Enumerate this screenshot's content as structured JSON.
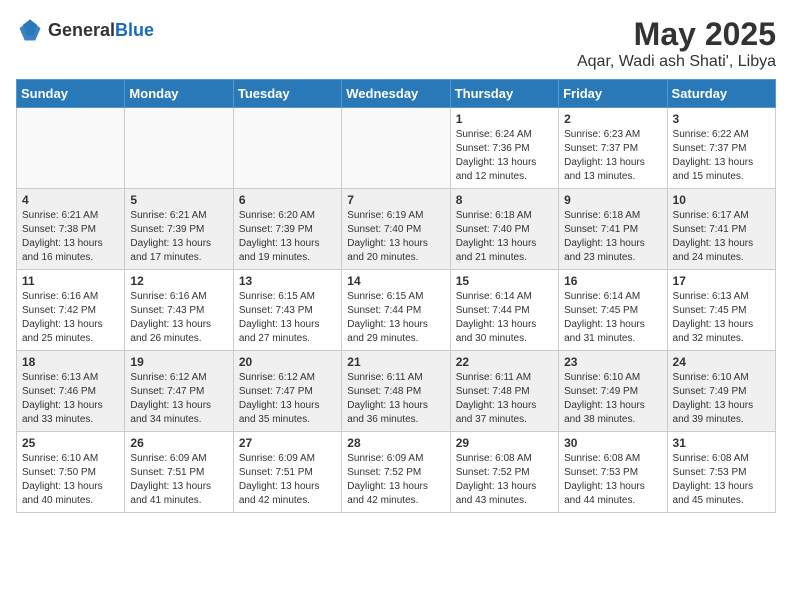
{
  "header": {
    "logo_general": "General",
    "logo_blue": "Blue",
    "month_year": "May 2025",
    "location": "Aqar, Wadi ash Shati', Libya"
  },
  "weekdays": [
    "Sunday",
    "Monday",
    "Tuesday",
    "Wednesday",
    "Thursday",
    "Friday",
    "Saturday"
  ],
  "weeks": [
    [
      {
        "day": "",
        "sunrise": "",
        "sunset": "",
        "daylight": ""
      },
      {
        "day": "",
        "sunrise": "",
        "sunset": "",
        "daylight": ""
      },
      {
        "day": "",
        "sunrise": "",
        "sunset": "",
        "daylight": ""
      },
      {
        "day": "",
        "sunrise": "",
        "sunset": "",
        "daylight": ""
      },
      {
        "day": "1",
        "sunrise": "Sunrise: 6:24 AM",
        "sunset": "Sunset: 7:36 PM",
        "daylight": "Daylight: 13 hours and 12 minutes."
      },
      {
        "day": "2",
        "sunrise": "Sunrise: 6:23 AM",
        "sunset": "Sunset: 7:37 PM",
        "daylight": "Daylight: 13 hours and 13 minutes."
      },
      {
        "day": "3",
        "sunrise": "Sunrise: 6:22 AM",
        "sunset": "Sunset: 7:37 PM",
        "daylight": "Daylight: 13 hours and 15 minutes."
      }
    ],
    [
      {
        "day": "4",
        "sunrise": "Sunrise: 6:21 AM",
        "sunset": "Sunset: 7:38 PM",
        "daylight": "Daylight: 13 hours and 16 minutes."
      },
      {
        "day": "5",
        "sunrise": "Sunrise: 6:21 AM",
        "sunset": "Sunset: 7:39 PM",
        "daylight": "Daylight: 13 hours and 17 minutes."
      },
      {
        "day": "6",
        "sunrise": "Sunrise: 6:20 AM",
        "sunset": "Sunset: 7:39 PM",
        "daylight": "Daylight: 13 hours and 19 minutes."
      },
      {
        "day": "7",
        "sunrise": "Sunrise: 6:19 AM",
        "sunset": "Sunset: 7:40 PM",
        "daylight": "Daylight: 13 hours and 20 minutes."
      },
      {
        "day": "8",
        "sunrise": "Sunrise: 6:18 AM",
        "sunset": "Sunset: 7:40 PM",
        "daylight": "Daylight: 13 hours and 21 minutes."
      },
      {
        "day": "9",
        "sunrise": "Sunrise: 6:18 AM",
        "sunset": "Sunset: 7:41 PM",
        "daylight": "Daylight: 13 hours and 23 minutes."
      },
      {
        "day": "10",
        "sunrise": "Sunrise: 6:17 AM",
        "sunset": "Sunset: 7:41 PM",
        "daylight": "Daylight: 13 hours and 24 minutes."
      }
    ],
    [
      {
        "day": "11",
        "sunrise": "Sunrise: 6:16 AM",
        "sunset": "Sunset: 7:42 PM",
        "daylight": "Daylight: 13 hours and 25 minutes."
      },
      {
        "day": "12",
        "sunrise": "Sunrise: 6:16 AM",
        "sunset": "Sunset: 7:43 PM",
        "daylight": "Daylight: 13 hours and 26 minutes."
      },
      {
        "day": "13",
        "sunrise": "Sunrise: 6:15 AM",
        "sunset": "Sunset: 7:43 PM",
        "daylight": "Daylight: 13 hours and 27 minutes."
      },
      {
        "day": "14",
        "sunrise": "Sunrise: 6:15 AM",
        "sunset": "Sunset: 7:44 PM",
        "daylight": "Daylight: 13 hours and 29 minutes."
      },
      {
        "day": "15",
        "sunrise": "Sunrise: 6:14 AM",
        "sunset": "Sunset: 7:44 PM",
        "daylight": "Daylight: 13 hours and 30 minutes."
      },
      {
        "day": "16",
        "sunrise": "Sunrise: 6:14 AM",
        "sunset": "Sunset: 7:45 PM",
        "daylight": "Daylight: 13 hours and 31 minutes."
      },
      {
        "day": "17",
        "sunrise": "Sunrise: 6:13 AM",
        "sunset": "Sunset: 7:45 PM",
        "daylight": "Daylight: 13 hours and 32 minutes."
      }
    ],
    [
      {
        "day": "18",
        "sunrise": "Sunrise: 6:13 AM",
        "sunset": "Sunset: 7:46 PM",
        "daylight": "Daylight: 13 hours and 33 minutes."
      },
      {
        "day": "19",
        "sunrise": "Sunrise: 6:12 AM",
        "sunset": "Sunset: 7:47 PM",
        "daylight": "Daylight: 13 hours and 34 minutes."
      },
      {
        "day": "20",
        "sunrise": "Sunrise: 6:12 AM",
        "sunset": "Sunset: 7:47 PM",
        "daylight": "Daylight: 13 hours and 35 minutes."
      },
      {
        "day": "21",
        "sunrise": "Sunrise: 6:11 AM",
        "sunset": "Sunset: 7:48 PM",
        "daylight": "Daylight: 13 hours and 36 minutes."
      },
      {
        "day": "22",
        "sunrise": "Sunrise: 6:11 AM",
        "sunset": "Sunset: 7:48 PM",
        "daylight": "Daylight: 13 hours and 37 minutes."
      },
      {
        "day": "23",
        "sunrise": "Sunrise: 6:10 AM",
        "sunset": "Sunset: 7:49 PM",
        "daylight": "Daylight: 13 hours and 38 minutes."
      },
      {
        "day": "24",
        "sunrise": "Sunrise: 6:10 AM",
        "sunset": "Sunset: 7:49 PM",
        "daylight": "Daylight: 13 hours and 39 minutes."
      }
    ],
    [
      {
        "day": "25",
        "sunrise": "Sunrise: 6:10 AM",
        "sunset": "Sunset: 7:50 PM",
        "daylight": "Daylight: 13 hours and 40 minutes."
      },
      {
        "day": "26",
        "sunrise": "Sunrise: 6:09 AM",
        "sunset": "Sunset: 7:51 PM",
        "daylight": "Daylight: 13 hours and 41 minutes."
      },
      {
        "day": "27",
        "sunrise": "Sunrise: 6:09 AM",
        "sunset": "Sunset: 7:51 PM",
        "daylight": "Daylight: 13 hours and 42 minutes."
      },
      {
        "day": "28",
        "sunrise": "Sunrise: 6:09 AM",
        "sunset": "Sunset: 7:52 PM",
        "daylight": "Daylight: 13 hours and 42 minutes."
      },
      {
        "day": "29",
        "sunrise": "Sunrise: 6:08 AM",
        "sunset": "Sunset: 7:52 PM",
        "daylight": "Daylight: 13 hours and 43 minutes."
      },
      {
        "day": "30",
        "sunrise": "Sunrise: 6:08 AM",
        "sunset": "Sunset: 7:53 PM",
        "daylight": "Daylight: 13 hours and 44 minutes."
      },
      {
        "day": "31",
        "sunrise": "Sunrise: 6:08 AM",
        "sunset": "Sunset: 7:53 PM",
        "daylight": "Daylight: 13 hours and 45 minutes."
      }
    ]
  ]
}
